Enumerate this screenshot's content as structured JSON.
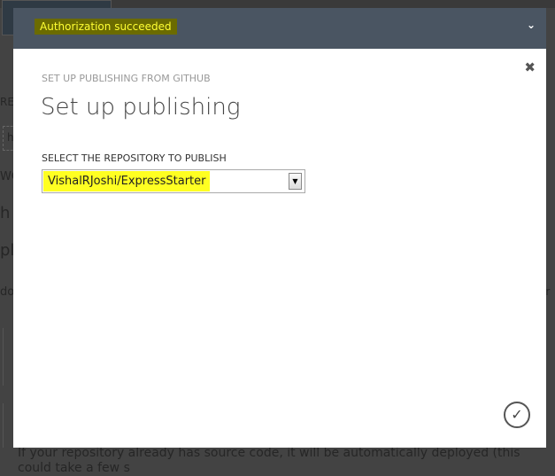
{
  "background": {
    "fragments": [
      "REP",
      "h",
      "WO",
      "h",
      "plo",
      "dov",
      "or"
    ],
    "bottom_text": "If your repository already has source code, it will be automatically deployed (this could take a few s"
  },
  "notification": {
    "message": "Authorization succeeded",
    "expand_icon": "chevron-down-icon"
  },
  "dialog": {
    "subtitle": "SET UP PUBLISHING FROM GITHUB",
    "title": "Set up publishing",
    "repo_label": "SELECT THE REPOSITORY TO PUBLISH",
    "repo_value": "VishalRJoshi/ExpressStarter",
    "close_icon": "close-icon",
    "confirm_icon": "checkmark-circle-icon"
  },
  "colors": {
    "header": "#4a5562",
    "highlight": "#ffff22"
  }
}
